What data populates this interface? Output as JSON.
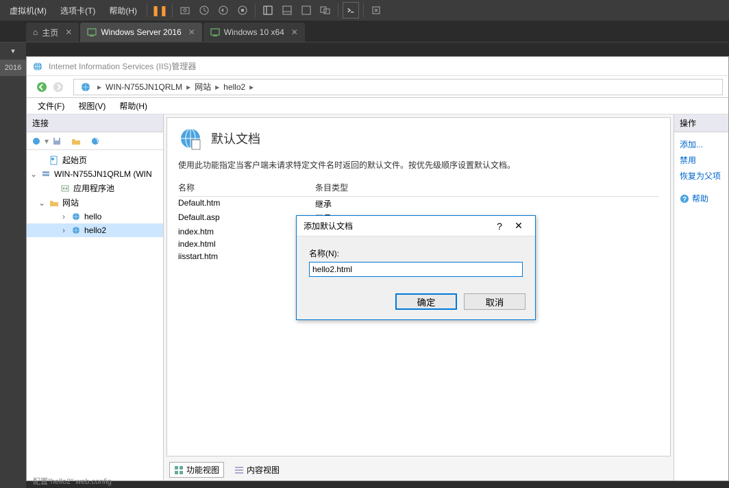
{
  "vm_menu": {
    "machine": "虚拟机(M)",
    "tabs": "选项卡(T)",
    "help": "帮助(H)"
  },
  "vm_tabs": [
    {
      "label": "主页",
      "type": "home"
    },
    {
      "label": "Windows Server 2016",
      "active": true
    },
    {
      "label": "Windows 10 x64"
    }
  ],
  "left_strip": [
    "2016"
  ],
  "iis": {
    "title": "Internet Information Services (IIS)管理器",
    "breadcrumb": [
      "WIN-N755JN1QRLM",
      "网站",
      "hello2"
    ],
    "menu": {
      "file": "文件(F)",
      "view": "视图(V)",
      "help": "帮助(H)"
    },
    "connections_header": "连接",
    "tree": {
      "start": "起始页",
      "server": "WIN-N755JN1QRLM (WIN",
      "apppools": "应用程序池",
      "sites": "网站",
      "site1": "hello",
      "site2": "hello2"
    },
    "center": {
      "title": "默认文档",
      "desc": "使用此功能指定当客户端未请求特定文件名时返回的默认文件。按优先级顺序设置默认文档。",
      "col_name": "名称",
      "col_type": "条目类型",
      "rows": [
        {
          "name": "Default.htm",
          "type": "继承"
        },
        {
          "name": "Default.asp",
          "type": "继承"
        },
        {
          "name": "index.htm",
          "type": ""
        },
        {
          "name": "index.html",
          "type": ""
        },
        {
          "name": "iisstart.htm",
          "type": ""
        }
      ],
      "view_features": "功能视图",
      "view_content": "内容视图"
    },
    "actions": {
      "header": "操作",
      "add": "添加...",
      "disable": "禁用",
      "restore": "恢复为父项",
      "help": "帮助"
    }
  },
  "dialog": {
    "title": "添加默认文档",
    "name_label": "名称(N):",
    "name_value": "hello2.html",
    "ok": "确定",
    "cancel": "取消"
  },
  "status": "配置\"hello2\" web.config"
}
